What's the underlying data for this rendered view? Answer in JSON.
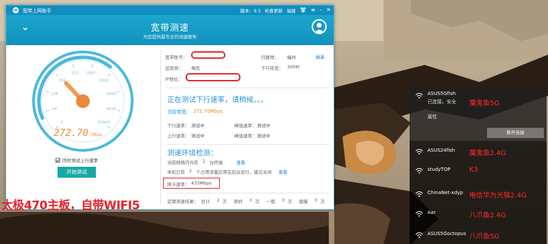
{
  "app": {
    "title": "宽带上网助手",
    "version": "版本：9.5",
    "check_update": "检查更新",
    "location_menu": "福建",
    "shirt_icon": "shirt-icon",
    "menu_icon": "menu-icon",
    "minimize_icon": "minimize-icon",
    "close_icon": "close-icon"
  },
  "header": {
    "title": "宽带测速",
    "subtitle": "为您提供最专业的测速服务",
    "collapse_icon": "chevron-down-icon",
    "avatar_icon": "avatar-icon"
  },
  "gauge": {
    "speed_value": "272.70",
    "speed_unit": "Mbps",
    "needle_level_mbps": 272.7,
    "ticks": [
      "0",
      "64",
      "128",
      "256",
      "512",
      "1000",
      "2000",
      "5000",
      "8000",
      "10000"
    ]
  },
  "controls": {
    "upload_checkbox_label": "同时测试上行速率",
    "upload_checked": true,
    "start_button": "开始测试"
  },
  "info": {
    "account_label": "宽带账号：",
    "region_label": "归属地：",
    "region_value": "福州",
    "refresh_link": "刷新",
    "operator_label": "运营商：",
    "operator_value": "电信",
    "downlink_label": "下行带宽：",
    "downlink_value": "300M",
    "ip_label": "IP地址："
  },
  "status": {
    "testing_text": "正在测试下行速率，请稍候。。。",
    "current_bw_label": "当前带宽：",
    "current_bw_value": "272.70Mbps",
    "down_rate_label": "下行速率：",
    "down_rate_value": "测试中",
    "down_peak_label": "峰值速率：",
    "down_peak_value": "测试中",
    "up_rate_label": "上行速率：",
    "up_rate_value": "测试中",
    "up_peak_label": "峰值速率：",
    "up_peak_value": "测试中"
  },
  "env": {
    "title": "测速环境检测：",
    "line1_prefix": "当前网络内共有",
    "line1_count": "2",
    "line1_suffix": "台终端",
    "line1_link": "查看",
    "line2_prefix": "本机已有",
    "line2_count": "2",
    "line2_suffix": "个占用流量应用在后台运行，建议关闭",
    "line2_link": "查看",
    "nic_label": "网卡速率：",
    "nic_value": "433Mbps"
  },
  "recent": {
    "label": "近期测速结果：",
    "total_label": "总计",
    "total_value": "2",
    "good_label": "很好",
    "good_value": "0",
    "normal_label": "一般",
    "normal_value": "0",
    "poor_label": "偏慢",
    "poor_value": "0",
    "unit": "次"
  },
  "overlay_text": "太极470主板，自带WIFI5",
  "wifi": {
    "connected": {
      "name": "ASUS5Gfish",
      "status": "已连接，安全",
      "properties": "属性",
      "disconnect": "断开连接",
      "annotation": "魔鬼鱼5G"
    },
    "networks": [
      {
        "name": "ASUS24fish",
        "annotation": "魔鬼鱼2.4G"
      },
      {
        "name": "studyTOP",
        "annotation": "K3"
      },
      {
        "name": "ChinaNet-xdyp",
        "annotation": "电信华为光猫2.4G"
      },
      {
        "name": "Aar",
        "annotation": "八爪鱼2.4G"
      },
      {
        "name": "ASUS5Goctopus",
        "annotation": "八爪鱼5G"
      }
    ]
  }
}
